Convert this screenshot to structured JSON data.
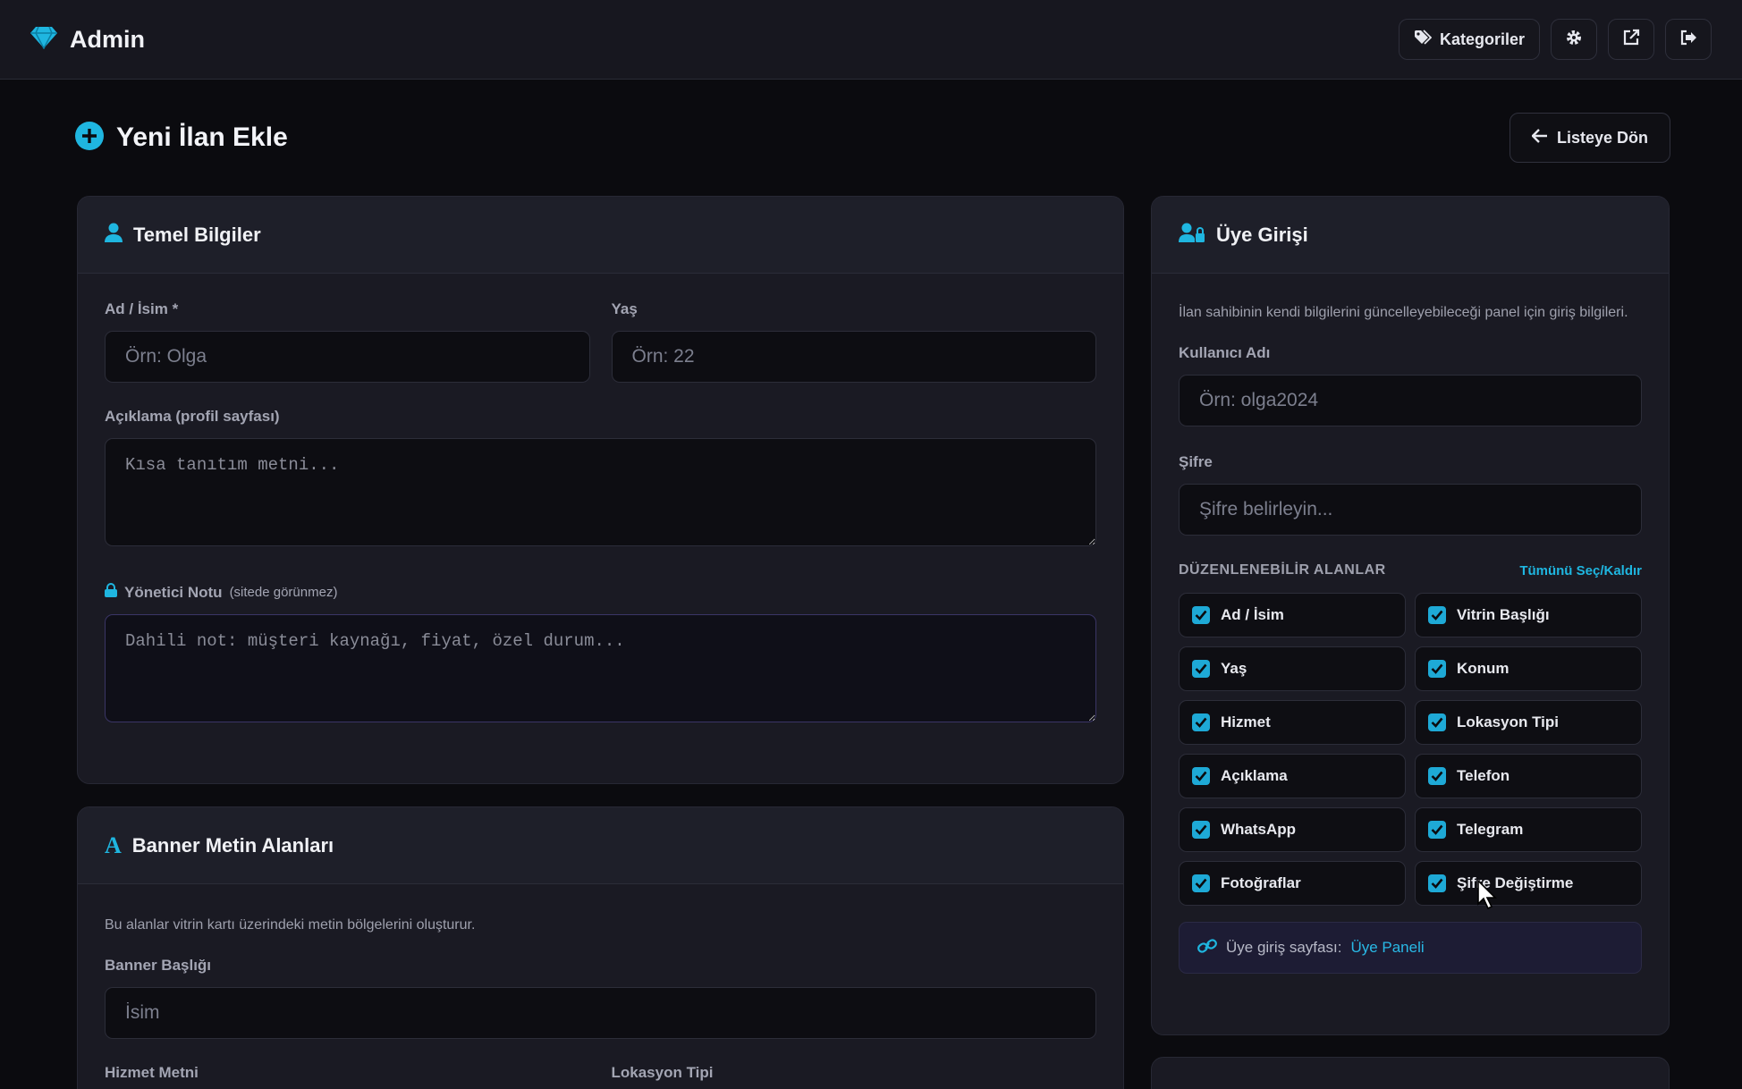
{
  "header": {
    "brand": "Admin",
    "categories_label": "Kategoriler",
    "brand_color": "#1fb6e0"
  },
  "page": {
    "title": "Yeni İlan Ekle",
    "back_label": "Listeye Dön"
  },
  "basic": {
    "title": "Temel Bilgiler",
    "name_label": "Ad / İsim *",
    "name_placeholder": "Örn: Olga",
    "age_label": "Yaş",
    "age_placeholder": "Örn: 22",
    "desc_label": "Açıklama (profil sayfası)",
    "desc_placeholder": "Kısa tanıtım metni...",
    "note_label": "Yönetici Notu",
    "note_hint": "(sitede görünmez)",
    "note_placeholder": "Dahili not: müşteri kaynağı, fiyat, özel durum..."
  },
  "banner": {
    "title": "Banner Metin Alanları",
    "description": "Bu alanlar vitrin kartı üzerindeki metin bölgelerini oluşturur.",
    "title_label": "Banner Başlığı",
    "title_placeholder": "İsim",
    "service_label": "Hizmet Metni",
    "location_label": "Lokasyon Tipi"
  },
  "member": {
    "title": "Üye Girişi",
    "description": "İlan sahibinin kendi bilgilerini güncelleyebileceği panel için giriş bilgileri.",
    "username_label": "Kullanıcı Adı",
    "username_placeholder": "Örn: olga2024",
    "password_label": "Şifre",
    "password_placeholder": "Şifre belirleyin...",
    "editable_title": "DÜZENLENEBİLİR ALANLAR",
    "toggle_all": "Tümünü Seç/Kaldır",
    "fields": [
      {
        "label": "Ad / İsim",
        "checked": true
      },
      {
        "label": "Vitrin Başlığı",
        "checked": true
      },
      {
        "label": "Yaş",
        "checked": true
      },
      {
        "label": "Konum",
        "checked": true
      },
      {
        "label": "Hizmet",
        "checked": true
      },
      {
        "label": "Lokasyon Tipi",
        "checked": true
      },
      {
        "label": "Açıklama",
        "checked": true
      },
      {
        "label": "Telefon",
        "checked": true
      },
      {
        "label": "WhatsApp",
        "checked": true
      },
      {
        "label": "Telegram",
        "checked": true
      },
      {
        "label": "Fotoğraflar",
        "checked": true
      },
      {
        "label": "Şifre Değiştirme",
        "checked": true
      }
    ],
    "login_page_label": "Üye giriş sayfası:",
    "login_page_link": "Üye Paneli"
  }
}
